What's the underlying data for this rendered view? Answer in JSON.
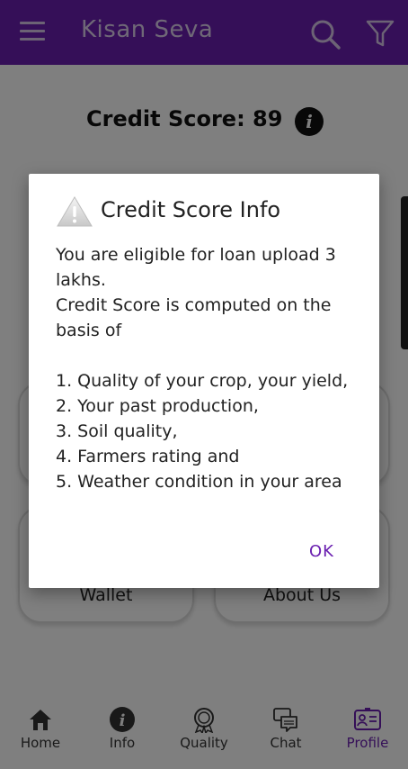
{
  "appbar": {
    "title": "Kisan Seva",
    "color": "#6a1fb0",
    "icons": [
      "menu-icon",
      "search-icon",
      "filter-icon"
    ]
  },
  "page": {
    "score_title": "Credit Score: 89",
    "cards": {
      "wallet": "Wallet",
      "about": "About Us"
    }
  },
  "dialog": {
    "title": "Credit Score Info",
    "icon": "warning-icon",
    "lines": [
      "You are eligible for loan upload 3 lakhs.",
      "Credit Score is computed on the basis of",
      "1. Quality of your crop, your yield,",
      "2. Your past production,",
      "3. Soil quality,",
      "4. Farmers rating and",
      "5. Weather condition in your area"
    ],
    "ok_label": "OK"
  },
  "bottom_nav": {
    "items": [
      {
        "label": "Home",
        "icon": "home-icon"
      },
      {
        "label": "Info",
        "icon": "info-icon"
      },
      {
        "label": "Quality",
        "icon": "quality-badge-icon"
      },
      {
        "label": "Chat",
        "icon": "chat-icon"
      },
      {
        "label": "Profile",
        "icon": "profile-card-icon"
      }
    ],
    "active_color": "#6a1fb0"
  }
}
